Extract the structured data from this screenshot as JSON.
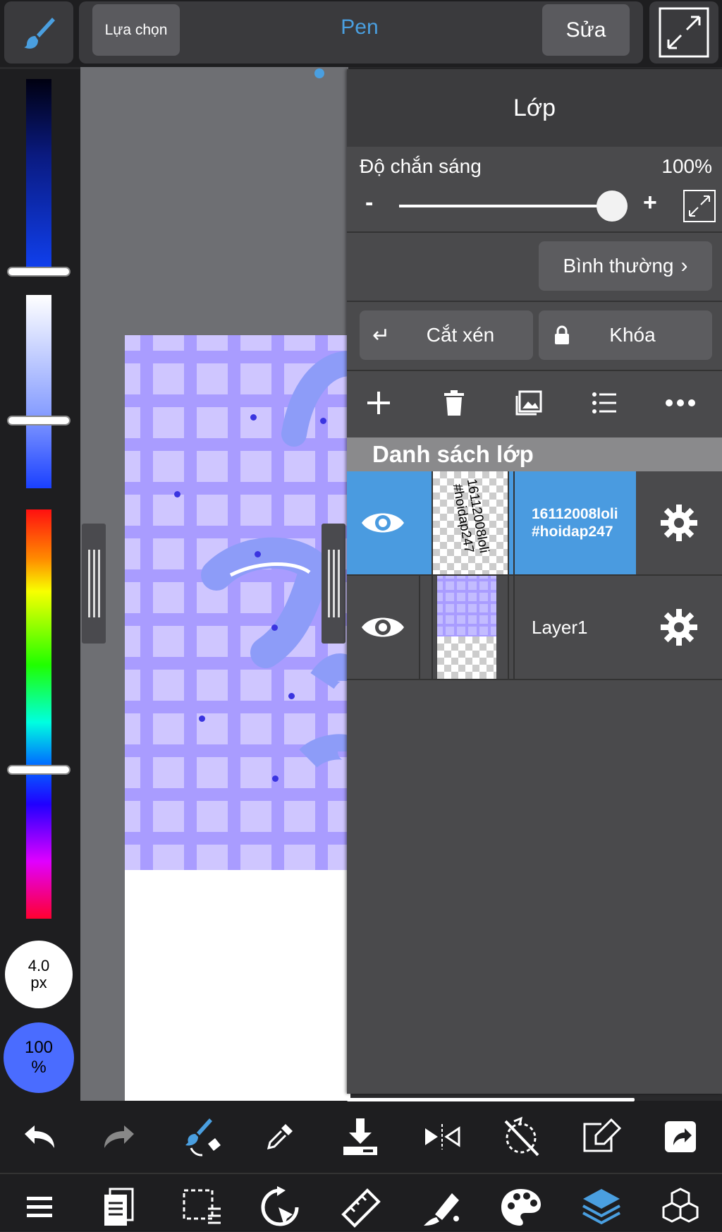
{
  "topbar": {
    "select_label": "Lựa chọn",
    "tool_name": "Pen",
    "edit_label": "Sửa"
  },
  "brush": {
    "size_value": "4.0",
    "size_unit": "px",
    "opacity_value": "100",
    "opacity_unit": "%"
  },
  "layer_panel": {
    "title": "Lớp",
    "opacity_label": "Độ chắn sáng",
    "opacity_value": "100%",
    "opacity_fraction": 1.0,
    "minus": "-",
    "plus": "+",
    "blend_mode": "Bình thường",
    "clip_label": "Cắt xén",
    "lock_label": "Khóa",
    "list_header": "Danh sách lớp",
    "layers": [
      {
        "name": "16112008loli #hoidap247",
        "name_line1": "16112008loli",
        "name_line2": "#hoidap247",
        "selected": true,
        "visible": true,
        "thumb_text": "16112008loli\n#hoidap247"
      },
      {
        "name": "Layer1",
        "selected": false,
        "visible": true
      }
    ]
  },
  "colors": {
    "accent": "#4a9fe0",
    "selected_layer": "#4a9be0",
    "panel": "#4a4a4c",
    "toolbar": "#1e1e20",
    "brush_color": "#4a6cff"
  },
  "bottom_tools_row1": [
    "undo-icon",
    "redo-icon",
    "brush-eraser-toggle-icon",
    "eyedropper-icon",
    "save-icon",
    "symmetry-icon",
    "transform-off-icon",
    "edit-canvas-icon",
    "share-icon"
  ],
  "bottom_tools_row2": [
    "menu-icon",
    "pages-icon",
    "selection-icon",
    "rotate-icon",
    "ruler-icon",
    "fill-icon",
    "palette-icon",
    "layers-icon",
    "materials-icon"
  ]
}
